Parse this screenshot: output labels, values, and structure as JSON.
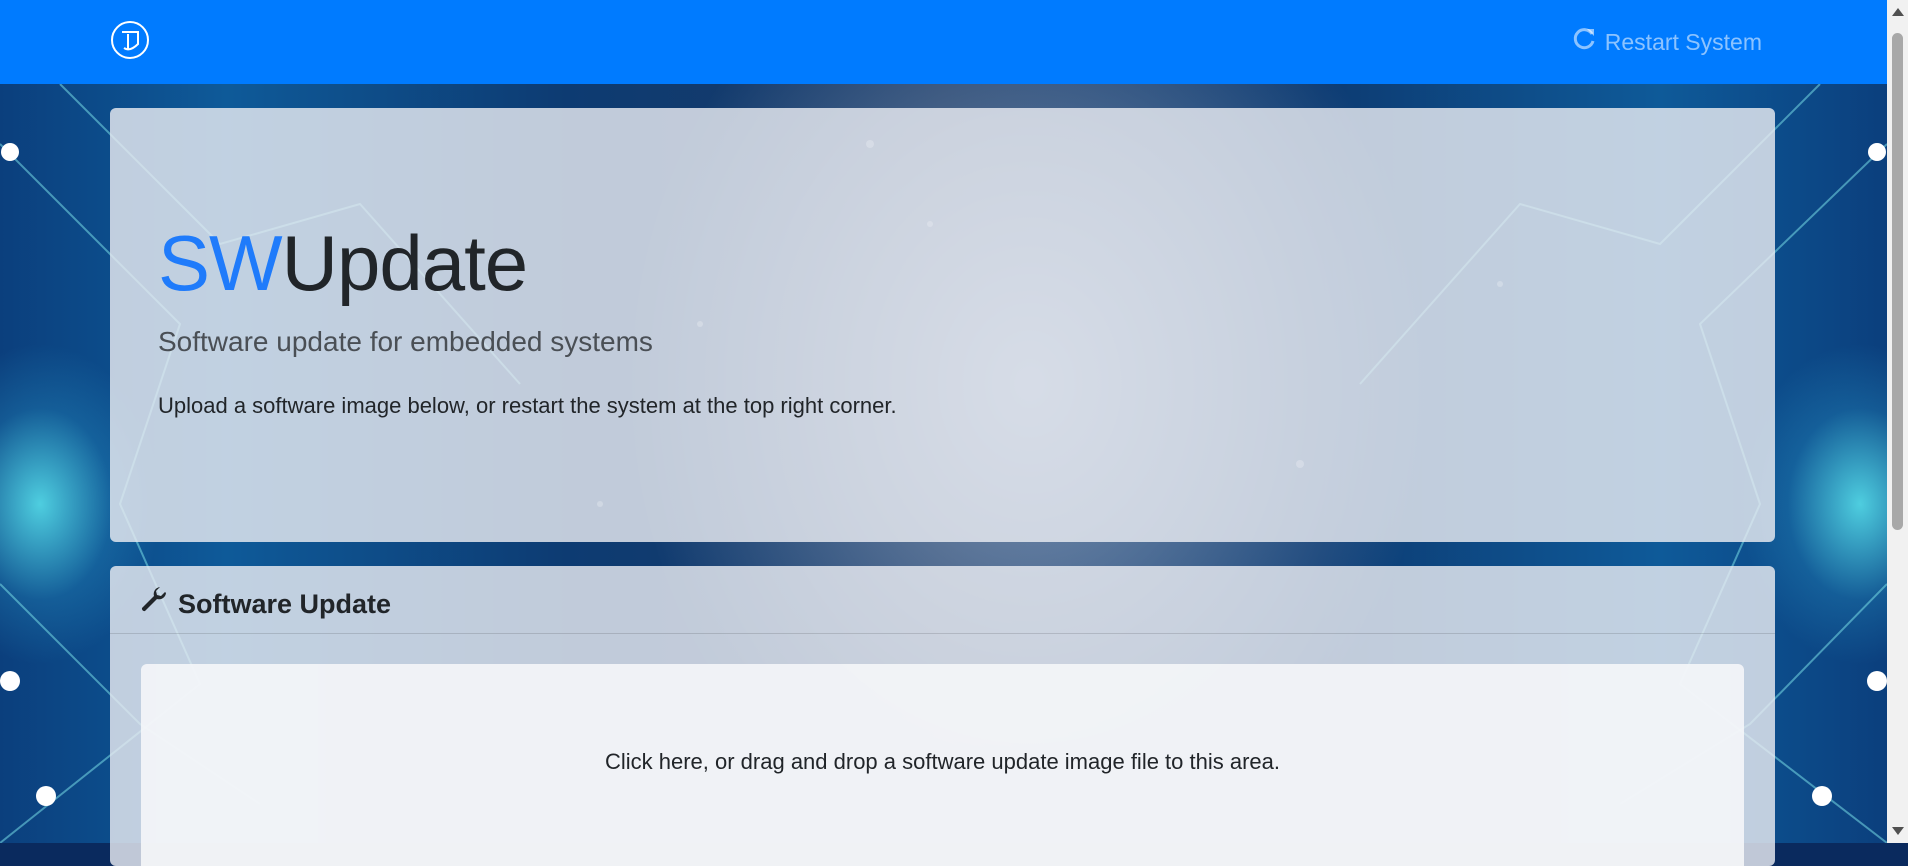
{
  "navbar": {
    "logo_icon": "swupdate-logo-icon",
    "restart_icon": "refresh-icon",
    "restart_label": "Restart System",
    "color": "#007bff"
  },
  "jumbotron": {
    "brand_sw": "SW",
    "brand_update": "Update",
    "lead": "Software update for embedded systems",
    "description": "Upload a software image below, or restart the system at the top right corner."
  },
  "software_update": {
    "icon": "wrench-icon",
    "title": "Software Update",
    "dropzone_text": "Click here, or drag and drop a software update image file to this area."
  },
  "colors": {
    "brand_accent": "#1f7bfb"
  }
}
